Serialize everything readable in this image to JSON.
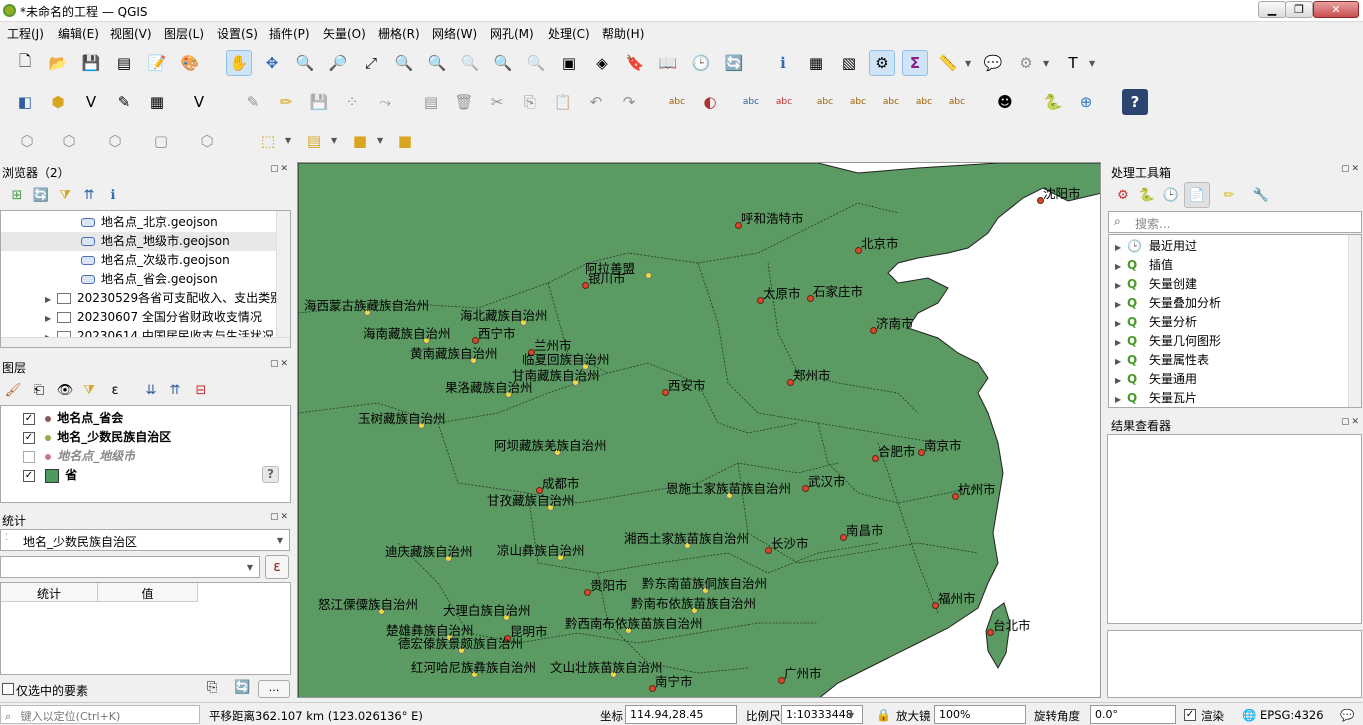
{
  "window": {
    "title": "*未命名的工程 — QGIS",
    "minimize": "▁",
    "maximize": "❐",
    "close": "✕"
  },
  "menu": [
    "工程(J)",
    "编辑(E)",
    "视图(V)",
    "图层(L)",
    "设置(S)",
    "插件(P)",
    "矢量(O)",
    "栅格(R)",
    "网络(W)",
    "网孔(M)",
    "处理(C)",
    "帮助(H)"
  ],
  "browser": {
    "title": "浏览器（2）",
    "files": [
      "地名点_北京.geojson",
      "地名点_地级市.geojson",
      "地名点_次级市.geojson",
      "地名点_省会.geojson"
    ],
    "folders": [
      "20230529各省可支配收入、支出类别",
      "20230607 全国分省财政收支情况",
      "20230614 中国居民收支与生活状况"
    ]
  },
  "layers": {
    "title": "图层",
    "items": [
      {
        "name": "地名点_省会",
        "checked": "✓",
        "color": "#8a5a5a"
      },
      {
        "name": "地名_少数民族自治区",
        "checked": "✓",
        "color": "#9aa84a"
      },
      {
        "name": "地名点_地级市",
        "checked": "",
        "color": "#c77d88"
      },
      {
        "name": "省",
        "checked": "✓",
        "color": "#4e9a5f"
      }
    ],
    "help": "?"
  },
  "stats": {
    "title": "统计",
    "layer": "地名_少数民族自治区",
    "col_stat": "统计",
    "col_value": "值",
    "selected_only": "仅选中的要素",
    "expr_btn": "ε",
    "more_btn": "..."
  },
  "processing": {
    "title": "处理工具箱",
    "search_placeholder": "搜索...",
    "items": [
      "最近用过",
      "插值",
      "矢量创建",
      "矢量叠加分析",
      "矢量分析",
      "矢量几何图形",
      "矢量属性表",
      "矢量通用",
      "矢量瓦片"
    ]
  },
  "results": {
    "title": "结果查看器"
  },
  "map": {
    "land_color": "#5b9a63",
    "capitals": [
      "沈阳市",
      "呼和浩特市",
      "北京市",
      "银川市",
      "太原市",
      "石家庄市",
      "济南市",
      "西宁市",
      "兰州市",
      "郑州市",
      "西安市",
      "南京市",
      "合肥市",
      "成都市",
      "武汉市",
      "杭州市",
      "南昌市",
      "长沙市",
      "贵阳市",
      "福州市",
      "台北市",
      "昆明市",
      "南宁市",
      "广州市"
    ],
    "autonomous": [
      "阿拉善盟",
      "海西蒙古族藏族自治州",
      "海北藏族自治州",
      "海南藏族自治州",
      "黄南藏族自治州",
      "临夏回族自治州",
      "甘南藏族自治州",
      "果洛藏族自治州",
      "玉树藏族自治州",
      "阿坝藏族羌族自治州",
      "恩施土家族苗族自治州",
      "甘孜藏族自治州",
      "湘西土家族苗族自治州",
      "迪庆藏族自治州",
      "凉山彝族自治州",
      "黔东南苗族侗族自治州",
      "黔南布依族苗族自治州",
      "怒江傈僳族自治州",
      "大理白族自治州",
      "楚雄彝族自治州",
      "黔西南布依族苗族自治州",
      "德宏傣族景颇族自治州",
      "红河哈尼族彝族自治州",
      "文山壮族苗族自治州"
    ]
  },
  "status": {
    "locate_placeholder": "键入以定位(Ctrl+K)",
    "message": "平移距离362.107 km (123.026136° E)",
    "coord_label": "坐标",
    "coord": "114.94,28.45",
    "scale_label": "比例尺",
    "scale": "1:10333448",
    "magnifier_label": "放大镜",
    "magnifier": "100%",
    "rotation_label": "旋转角度",
    "rotation": "0.0°",
    "render_label": "渲染",
    "crs": "EPSG:4326"
  }
}
